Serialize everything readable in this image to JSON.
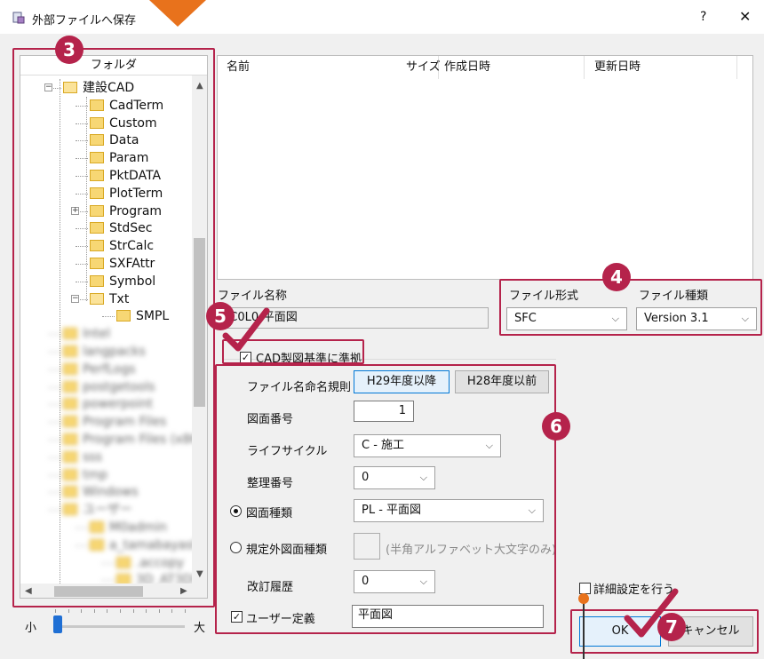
{
  "window": {
    "title": "外部ファイルへ保存",
    "help": "?",
    "close": "✕"
  },
  "tree": {
    "header": "フォルダ",
    "items": [
      {
        "label": "建設CAD",
        "level": 0,
        "expanded": true
      },
      {
        "label": "CadTerm",
        "level": 1
      },
      {
        "label": "Custom",
        "level": 1
      },
      {
        "label": "Data",
        "level": 1
      },
      {
        "label": "Param",
        "level": 1
      },
      {
        "label": "PktDATA",
        "level": 1
      },
      {
        "label": "PlotTerm",
        "level": 1
      },
      {
        "label": "Program",
        "level": 1,
        "expandable": true
      },
      {
        "label": "StdSec",
        "level": 1
      },
      {
        "label": "StrCalc",
        "level": 1
      },
      {
        "label": "SXFAttr",
        "level": 1
      },
      {
        "label": "Symbol",
        "level": 1
      },
      {
        "label": "Txt",
        "level": 1,
        "expanded": true
      },
      {
        "label": "SMPL",
        "level": 2
      }
    ],
    "blurred_items": [
      {
        "label": "Intel",
        "level": 0
      },
      {
        "label": "langpacks",
        "level": 0
      },
      {
        "label": "PerfLogs",
        "level": 0
      },
      {
        "label": "postgetools",
        "level": 0
      },
      {
        "label": "powerpoint",
        "level": 0
      },
      {
        "label": "Program Files",
        "level": 0
      },
      {
        "label": "Program Files (x86)",
        "level": 0
      },
      {
        "label": "sss",
        "level": 0
      },
      {
        "label": "tmp",
        "level": 0
      },
      {
        "label": "Windows",
        "level": 0
      },
      {
        "label": "ユーザー",
        "level": 0
      },
      {
        "label": "M0admin",
        "level": 1
      },
      {
        "label": "a_tamabayashi_",
        "level": 1
      },
      {
        "label": ".accopy",
        "level": 2
      },
      {
        "label": "3D_AT3DIv",
        "level": 2
      }
    ]
  },
  "zoom": {
    "small": "小",
    "large": "大",
    "value": 0.0
  },
  "filelist": {
    "columns": [
      "名前",
      "サイズ",
      "作成日時",
      "更新日時"
    ]
  },
  "filename": {
    "label": "ファイル名称",
    "value": "LC0L0-平面図"
  },
  "format": {
    "type_label": "ファイル形式",
    "type_value": "SFC",
    "kind_label": "ファイル種類",
    "kind_value": "Version 3.1"
  },
  "cad_standard": {
    "checkbox_label": "CAD製図基準に準拠",
    "checked": true,
    "naming_label": "ファイル名命名規則",
    "naming_new": "H29年度以降",
    "naming_old": "H28年度以前",
    "drawing_no_label": "図面番号",
    "drawing_no_value": "1",
    "lifecycle_label": "ライフサイクル",
    "lifecycle_value": "C - 施工",
    "seq_label": "整理番号",
    "seq_value": "0",
    "drawing_type_label": "図面種類",
    "drawing_type_value": "PL - 平面図",
    "nonstd_type_label": "規定外図面種類",
    "nonstd_type_hint": "(半角アルファベット大文字のみ)",
    "revision_label": "改訂履歴",
    "revision_value": "0",
    "user_def_label": "ユーザー定義",
    "user_def_value": "平面図"
  },
  "advanced": {
    "label": "詳細設定を行う"
  },
  "buttons": {
    "ok": "OK",
    "cancel": "キャンセル"
  },
  "callouts": {
    "n3": "3",
    "n4": "4",
    "n5": "5",
    "n6": "6",
    "n7": "7"
  },
  "colors": {
    "callout": "#b5234b",
    "accent_orange": "#e8721c",
    "selection_blue": "#0078d7"
  }
}
